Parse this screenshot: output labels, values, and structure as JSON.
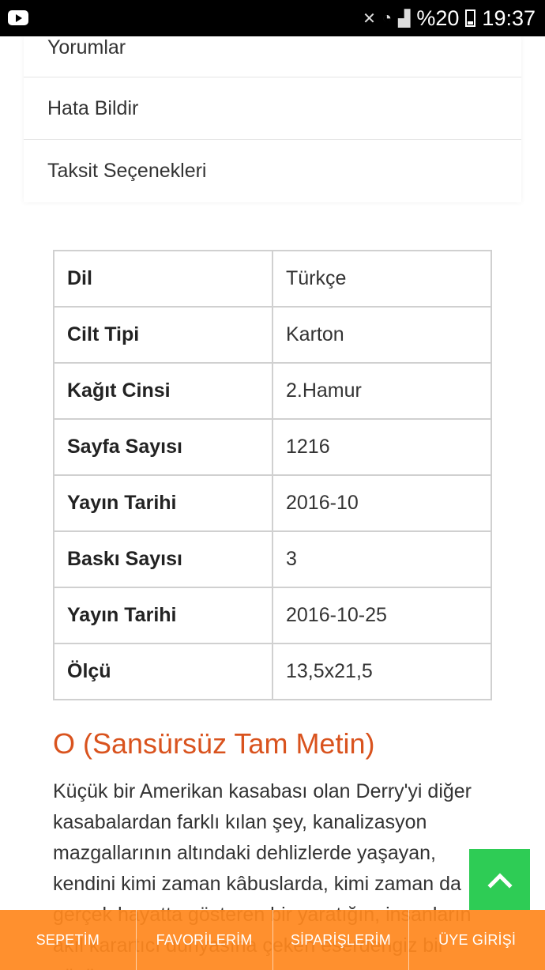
{
  "status_bar": {
    "battery_percent": "%20",
    "time": "19:37",
    "icons": [
      "youtube-icon",
      "mute-icon",
      "wifi-icon",
      "signal-icon",
      "battery-icon"
    ]
  },
  "menu": {
    "items": [
      {
        "label": "Yorumlar"
      },
      {
        "label": "Hata Bildir"
      },
      {
        "label": "Taksit Seçenekleri"
      }
    ]
  },
  "specs": {
    "rows": [
      {
        "key": "Dil",
        "value": "Türkçe"
      },
      {
        "key": "Cilt Tipi",
        "value": "Karton"
      },
      {
        "key": "Kağıt Cinsi",
        "value": "2.Hamur"
      },
      {
        "key": "Sayfa Sayısı",
        "value": "1216"
      },
      {
        "key": "Yayın Tarihi",
        "value": "2016-10"
      },
      {
        "key": "Baskı Sayısı",
        "value": "3"
      },
      {
        "key": "Yayın Tarihi",
        "value": "2016-10-25"
      },
      {
        "key": "Ölçü",
        "value": "13,5x21,5"
      }
    ]
  },
  "description": {
    "title": "O (Sansürsüz Tam Metin)",
    "text": "Küçük bir Amerikan kasabası olan Derry'yi diğer kasabalardan farklı kılan şey, kanalizasyon mazgallarının altındaki dehlizlerde yaşayan, kendini kimi zaman kâbuslarda, kimi zaman da gerçek hayatta gösteren bir yaratığın, insanların akıl karartıcı dünyasına çeken eserdengiz bir güçün"
  },
  "bottom_nav": {
    "items": [
      {
        "label": "SEPETİM"
      },
      {
        "label": "FAVORİLERİM"
      },
      {
        "label": "SİPARİŞLERİM"
      },
      {
        "label": "ÜYE GİRİŞİ"
      }
    ]
  },
  "colors": {
    "accent_orange": "#ff881e",
    "title_orange": "#d9531e",
    "scroll_top_green": "#2ecc55"
  }
}
